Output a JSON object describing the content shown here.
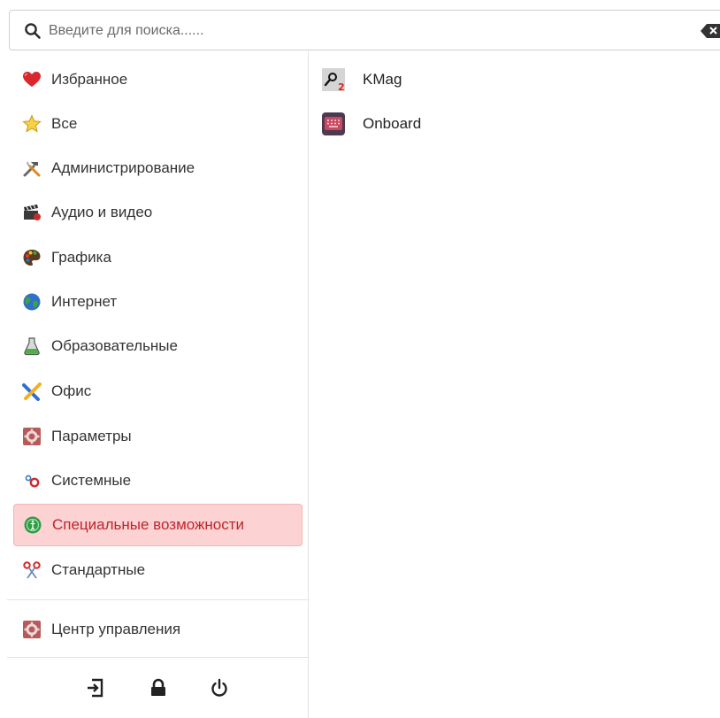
{
  "search": {
    "placeholder": "Введите для поиска......",
    "value": ""
  },
  "categories": [
    {
      "label": "Избранное",
      "icon": "heart-icon"
    },
    {
      "label": "Все",
      "icon": "star-icon"
    },
    {
      "label": "Администрирование",
      "icon": "tools-icon"
    },
    {
      "label": "Аудио и видео",
      "icon": "clapperboard-icon"
    },
    {
      "label": "Графика",
      "icon": "palette-icon"
    },
    {
      "label": "Интернет",
      "icon": "globe-icon"
    },
    {
      "label": "Образовательные",
      "icon": "flask-icon"
    },
    {
      "label": "Офис",
      "icon": "office-icon"
    },
    {
      "label": "Параметры",
      "icon": "settings-icon"
    },
    {
      "label": "Системные",
      "icon": "system-icon"
    },
    {
      "label": "Специальные возможности",
      "icon": "accessibility-icon",
      "active": true
    },
    {
      "label": "Стандартные",
      "icon": "scissors-icon"
    }
  ],
  "control_center": {
    "label": "Центр управления",
    "icon": "control-center-icon"
  },
  "apps": [
    {
      "label": "KMag",
      "icon": "kmag-icon"
    },
    {
      "label": "Onboard",
      "icon": "keyboard-icon"
    }
  ],
  "colors": {
    "active_bg": "#fcd2d3",
    "active_text": "#c0242b",
    "border": "#e2e2e2"
  }
}
